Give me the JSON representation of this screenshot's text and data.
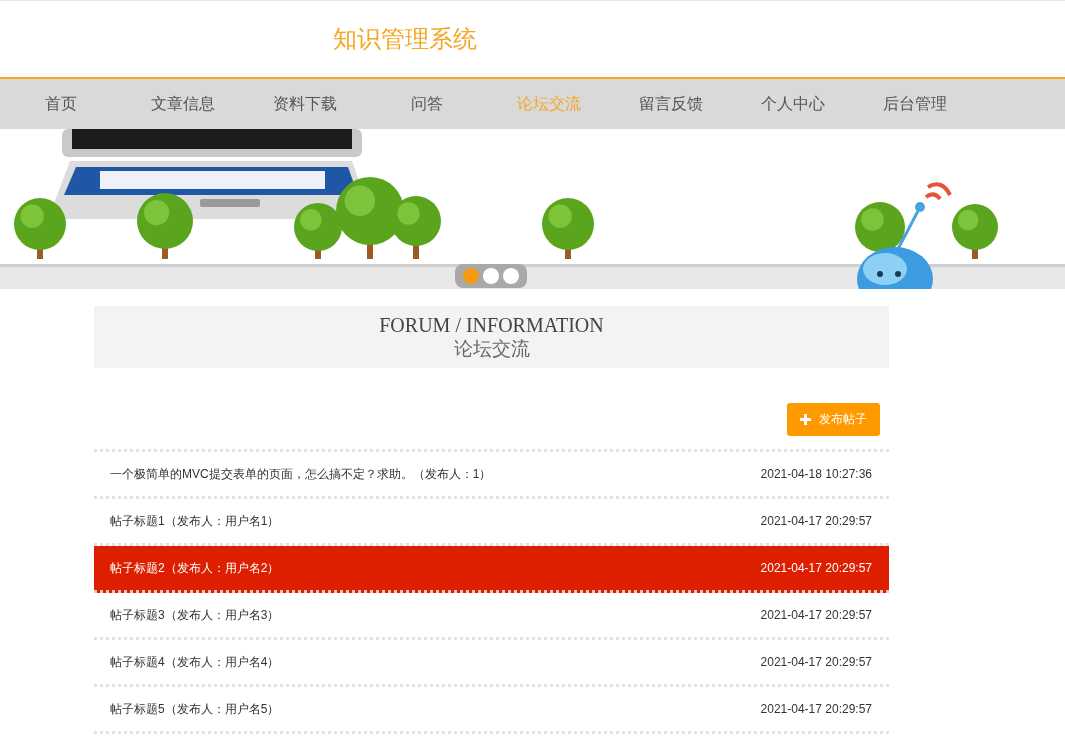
{
  "header": {
    "title": "知识管理系统"
  },
  "nav": [
    {
      "label": "首页",
      "selected": false
    },
    {
      "label": "文章信息",
      "selected": false
    },
    {
      "label": "资料下载",
      "selected": false
    },
    {
      "label": "问答",
      "selected": false
    },
    {
      "label": "论坛交流",
      "selected": true
    },
    {
      "label": "留言反馈",
      "selected": false
    },
    {
      "label": "个人中心",
      "selected": false
    },
    {
      "label": "后台管理",
      "selected": false
    }
  ],
  "banner": {
    "dots": [
      {
        "selected": true
      },
      {
        "selected": false
      },
      {
        "selected": false
      }
    ]
  },
  "section": {
    "title_en": "FORUM / INFORMATION",
    "title_zh": "论坛交流"
  },
  "post_button": {
    "label": "发布帖子"
  },
  "posts": [
    {
      "title": "一个极简单的MVC提交表单的页面，怎么搞不定？求助。（发布人：1）",
      "date": "2021-04-18 10:27:36",
      "selected": false
    },
    {
      "title": "帖子标题1（发布人：用户名1）",
      "date": "2021-04-17 20:29:57",
      "selected": false
    },
    {
      "title": "帖子标题2（发布人：用户名2）",
      "date": "2021-04-17 20:29:57",
      "selected": true
    },
    {
      "title": "帖子标题3（发布人：用户名3）",
      "date": "2021-04-17 20:29:57",
      "selected": false
    },
    {
      "title": "帖子标题4（发布人：用户名4）",
      "date": "2021-04-17 20:29:57",
      "selected": false
    },
    {
      "title": "帖子标题5（发布人：用户名5）",
      "date": "2021-04-17 20:29:57",
      "selected": false
    }
  ]
}
